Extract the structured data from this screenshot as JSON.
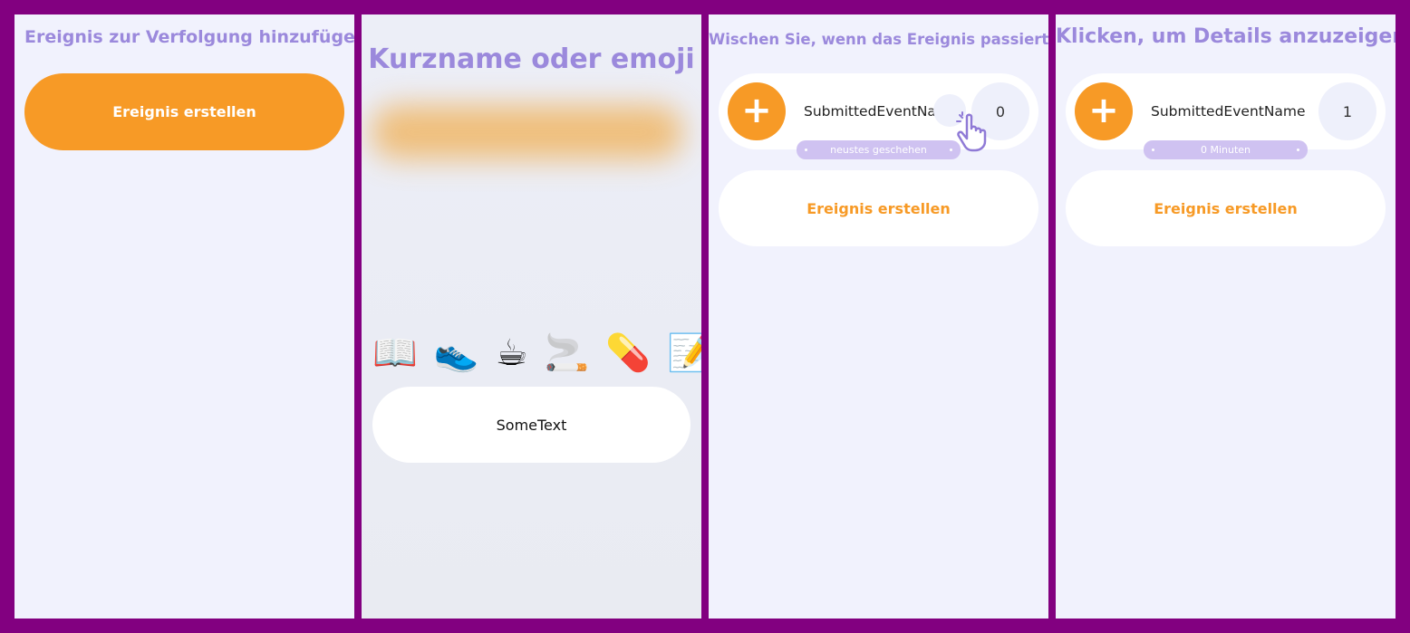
{
  "panel1": {
    "title": "Ereignis zur Verfolgung hinzufügen",
    "create_button": "Ereignis erstellen"
  },
  "panel2": {
    "title": "Kurzname oder emoji",
    "emojis": [
      "📖",
      "👟",
      "☕",
      "🚬",
      "💊",
      "📝"
    ],
    "text_value": "SomeText"
  },
  "panel3": {
    "title": "Wischen Sie, wenn das Ereignis passiert ist",
    "event_name": "SubmittedEventName",
    "count": "0",
    "chip_text": "neustes geschehen",
    "create_button": "Ereignis erstellen"
  },
  "panel4": {
    "title": "Klicken, um Details anzuzeigen",
    "event_name": "SubmittedEventName",
    "count": "1",
    "chip_text": "0 Minuten",
    "create_button": "Ereignis erstellen"
  },
  "icons": {
    "plus": "+",
    "hand": "pointing-hand-icon"
  },
  "colors": {
    "frame": "#820080",
    "accent_orange": "#f79a26",
    "title_purple": "#9b89dc",
    "chip_purple": "#cfc2f1",
    "panel_bg": "#f1f2fd"
  }
}
